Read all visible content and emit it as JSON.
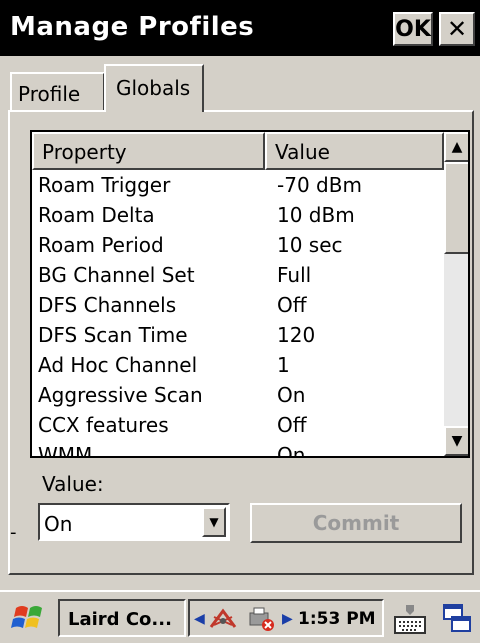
{
  "window": {
    "title": "Manage Profiles",
    "ok_label": "OK",
    "close_label": "✕"
  },
  "tabs": [
    {
      "label": "Profile",
      "selected": false
    },
    {
      "label": "Globals",
      "selected": true
    }
  ],
  "list": {
    "columns": [
      "Property",
      "Value"
    ],
    "rows": [
      {
        "property": "Roam Trigger",
        "value": "-70 dBm"
      },
      {
        "property": "Roam Delta",
        "value": "10 dBm"
      },
      {
        "property": "Roam Period",
        "value": "10 sec"
      },
      {
        "property": "BG Channel Set",
        "value": "Full"
      },
      {
        "property": "DFS Channels",
        "value": "Off"
      },
      {
        "property": "DFS Scan Time",
        "value": "120"
      },
      {
        "property": "Ad Hoc Channel",
        "value": "1"
      },
      {
        "property": "Aggressive Scan",
        "value": "On"
      },
      {
        "property": "CCX features",
        "value": "Off"
      },
      {
        "property": "WMM",
        "value": "On"
      }
    ]
  },
  "value_section": {
    "label": "Value:",
    "selected_value": "On",
    "commit_label": "Commit",
    "commit_enabled": false
  },
  "taskbar": {
    "task_label": "Laird Co...",
    "clock": "1:53 PM",
    "icons": [
      "start-icon",
      "network-icon",
      "printer-error-icon",
      "keyboard-icon",
      "windows-icon"
    ]
  },
  "colors": {
    "titlebar": "#000000",
    "face": "#d4d0c8",
    "tray_arrow": "#1a3ea8"
  }
}
